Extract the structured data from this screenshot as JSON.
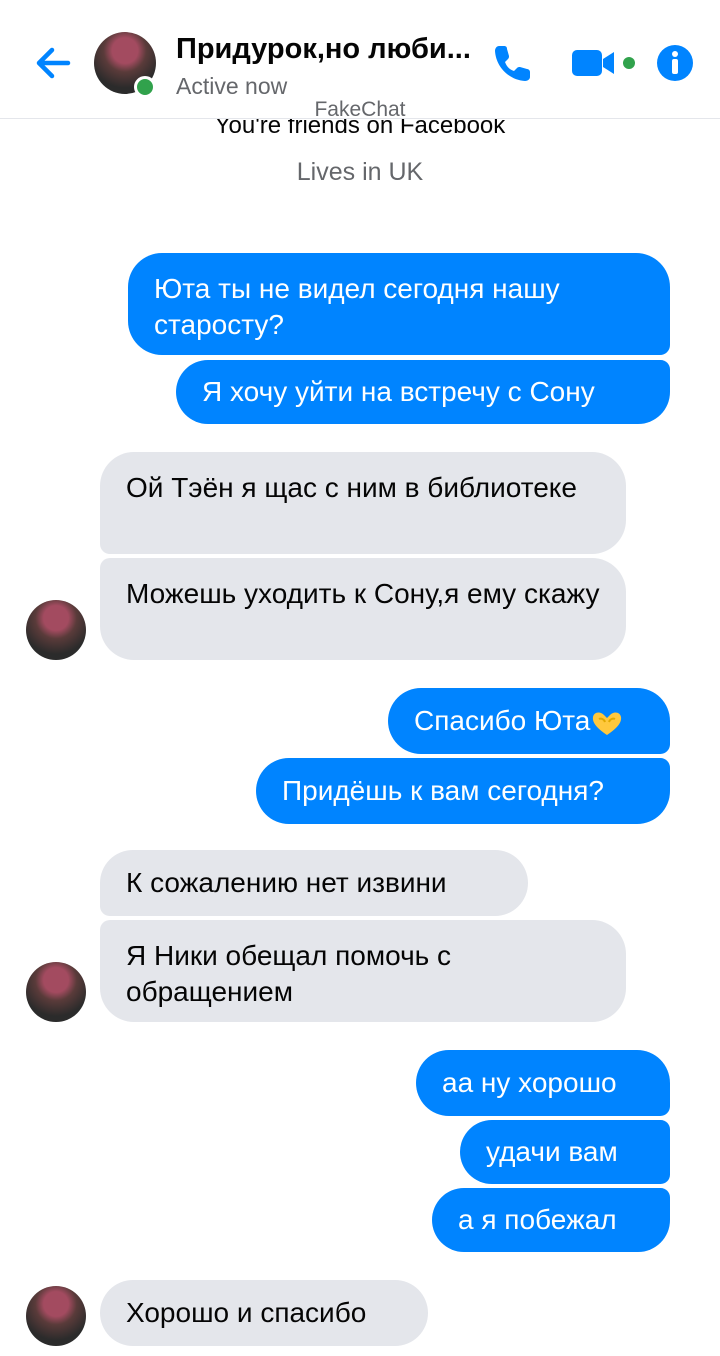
{
  "header": {
    "contact_name": "Придурок,но люби...",
    "status": "Active now",
    "icons": {
      "back": "back-arrow-icon",
      "call": "phone-icon",
      "video": "video-camera-icon",
      "info": "info-icon"
    },
    "accent_color": "#0084ff"
  },
  "watermark": "FakeChat",
  "intro": {
    "friends": "You're friends on Facebook",
    "lives": "Lives in UK"
  },
  "messages": [
    {
      "dir": "out",
      "text": "Юта ты не видел сегодня нашу старосту?"
    },
    {
      "dir": "out",
      "text": "Я хочу уйти на встречу с Сону"
    },
    {
      "dir": "in",
      "text": "Ой Тэён я щас с ним в библиотеке"
    },
    {
      "dir": "in",
      "text": "Можешь уходить к Сону,я ему скажу"
    },
    {
      "dir": "out",
      "text": "Спасибо Юта"
    },
    {
      "dir": "out",
      "text": "Придёшь к вам сегодня?"
    },
    {
      "dir": "in",
      "text": "К сожалению нет извини"
    },
    {
      "dir": "in",
      "text": "Я Ники обещал помочь с обращением"
    },
    {
      "dir": "out",
      "text": "аа ну хорошо"
    },
    {
      "dir": "out",
      "text": "удачи вам"
    },
    {
      "dir": "out",
      "text": "а я побежал"
    },
    {
      "dir": "in",
      "text": "Хорошо и спасибо"
    }
  ],
  "emoji": "heart-hands-emoji"
}
